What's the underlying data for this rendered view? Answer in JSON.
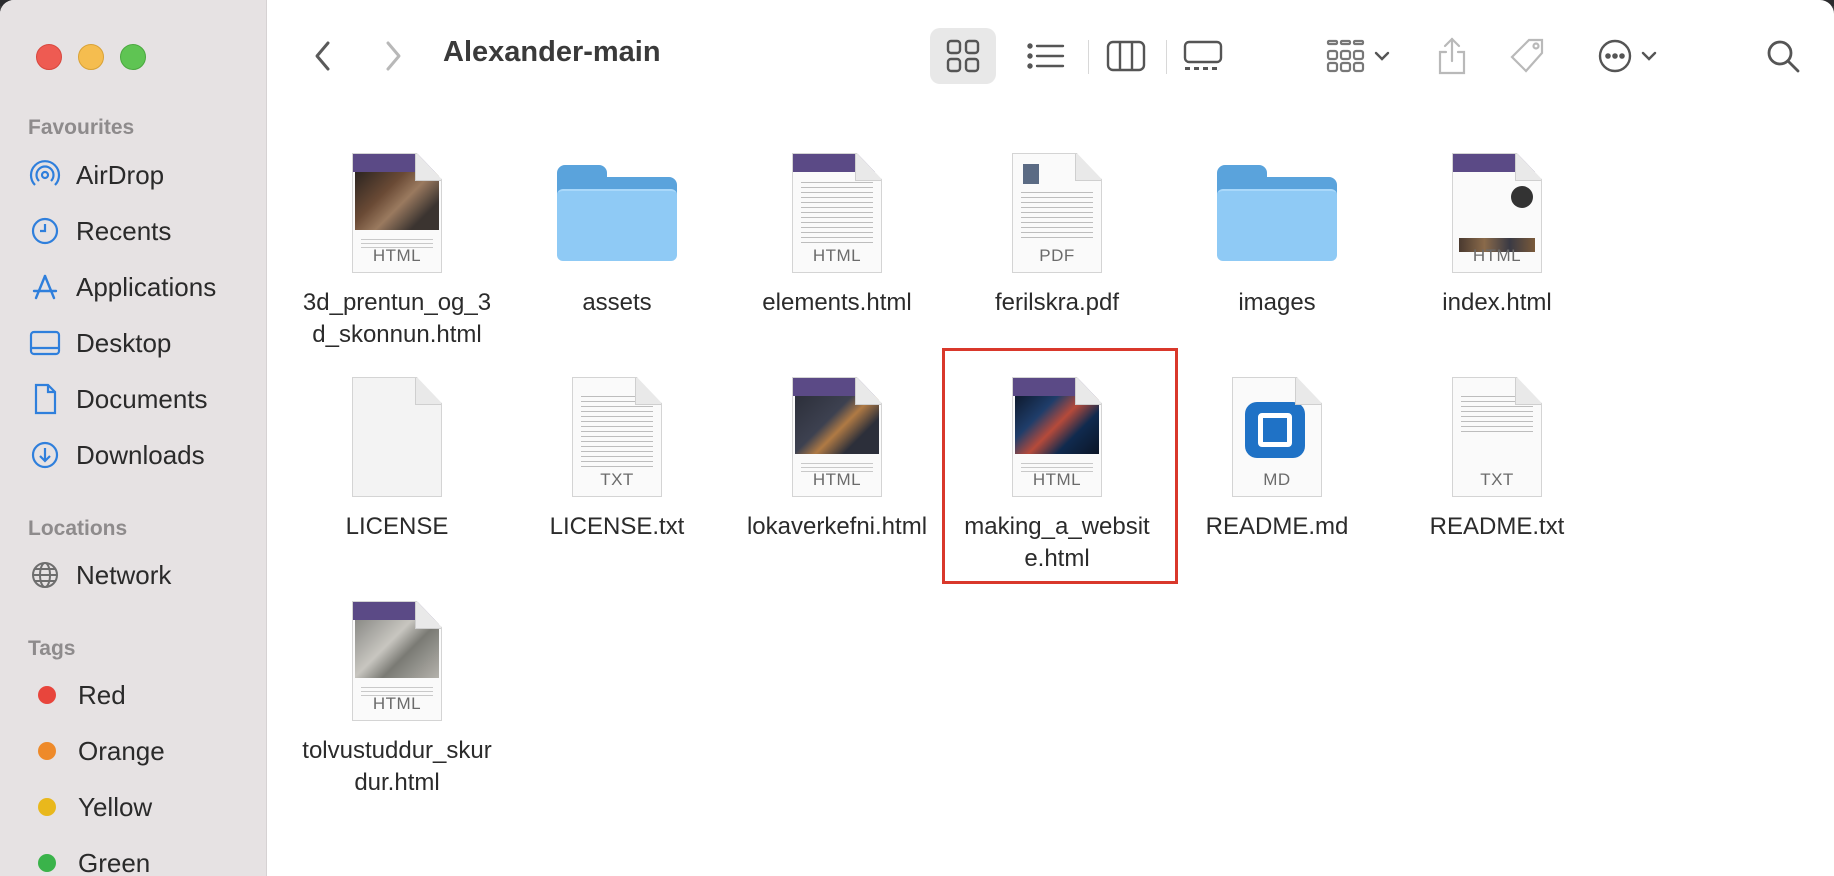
{
  "window": {
    "title": "Alexander-main"
  },
  "sidebar": {
    "favourites_label": "Favourites",
    "favourites": [
      {
        "label": "AirDrop",
        "icon": "airdrop-icon"
      },
      {
        "label": "Recents",
        "icon": "clock-icon"
      },
      {
        "label": "Applications",
        "icon": "applications-icon"
      },
      {
        "label": "Desktop",
        "icon": "desktop-icon"
      },
      {
        "label": "Documents",
        "icon": "document-icon"
      },
      {
        "label": "Downloads",
        "icon": "download-icon"
      }
    ],
    "locations_label": "Locations",
    "locations": [
      {
        "label": "Network",
        "icon": "globe-icon"
      }
    ],
    "tags_label": "Tags",
    "tags": [
      {
        "label": "Red",
        "color": "#e8453c"
      },
      {
        "label": "Orange",
        "color": "#ee8a2a"
      },
      {
        "label": "Yellow",
        "color": "#e9b81c"
      },
      {
        "label": "Green",
        "color": "#3ab34a"
      }
    ]
  },
  "toolbar": {
    "back": "chevron-left-icon",
    "forward": "chevron-right-icon",
    "views": [
      "icon-view",
      "list-view",
      "column-view",
      "gallery-view"
    ],
    "active_view": "icon-view"
  },
  "files": [
    {
      "name": "3d_prentun_og_3d_skonnun.html",
      "line1": "3d_prentun_og_3",
      "line2": "d_skonnun.html",
      "kind": "html",
      "ext": "HTML"
    },
    {
      "name": "assets",
      "line1": "assets",
      "line2": "",
      "kind": "folder",
      "ext": ""
    },
    {
      "name": "elements.html",
      "line1": "elements.html",
      "line2": "",
      "kind": "html",
      "ext": "HTML"
    },
    {
      "name": "ferilskra.pdf",
      "line1": "ferilskra.pdf",
      "line2": "",
      "kind": "pdf",
      "ext": "PDF"
    },
    {
      "name": "images",
      "line1": "images",
      "line2": "",
      "kind": "folder",
      "ext": ""
    },
    {
      "name": "index.html",
      "line1": "index.html",
      "line2": "",
      "kind": "html",
      "ext": "HTML"
    },
    {
      "name": "LICENSE",
      "line1": "LICENSE",
      "line2": "",
      "kind": "blank",
      "ext": ""
    },
    {
      "name": "LICENSE.txt",
      "line1": "LICENSE.txt",
      "line2": "",
      "kind": "txt",
      "ext": "TXT"
    },
    {
      "name": "lokaverkefni.html",
      "line1": "lokaverkefni.html",
      "line2": "",
      "kind": "html",
      "ext": "HTML"
    },
    {
      "name": "making_a_website.html",
      "line1": "making_a_websit",
      "line2": "e.html",
      "kind": "html",
      "ext": "HTML",
      "selected": true
    },
    {
      "name": "README.md",
      "line1": "README.md",
      "line2": "",
      "kind": "md",
      "ext": "MD"
    },
    {
      "name": "README.txt",
      "line1": "README.txt",
      "line2": "",
      "kind": "txt",
      "ext": "TXT"
    },
    {
      "name": "tolvustuddur_skurdur.html",
      "line1": "tolvustuddur_skur",
      "line2": "dur.html",
      "kind": "html",
      "ext": "HTML"
    }
  ]
}
